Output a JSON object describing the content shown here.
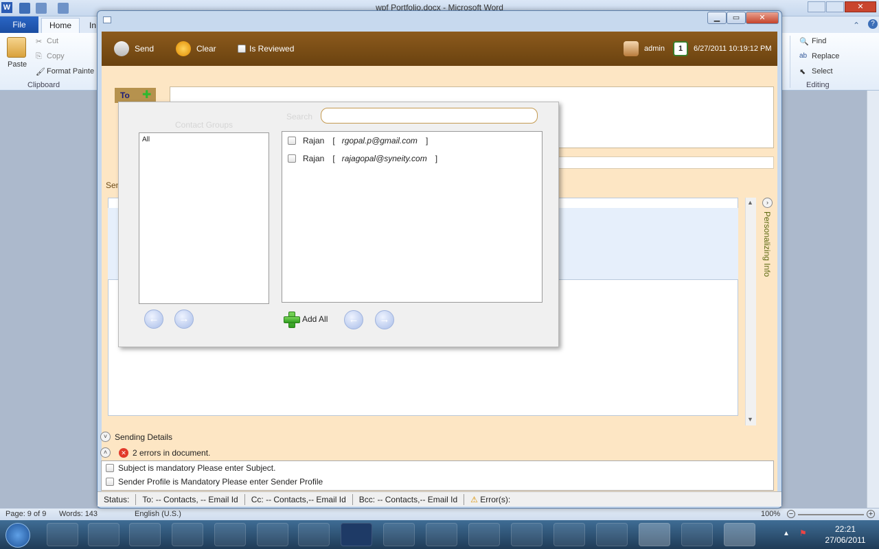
{
  "word": {
    "title": "wpf Portfolio.docx - Microsoft Word",
    "tabs": {
      "file": "File",
      "home": "Home",
      "insert": "In"
    },
    "clipboard": {
      "paste": "Paste",
      "cut": "Cut",
      "copy": "Copy",
      "format_painter": "Format Painte",
      "group": "Clipboard"
    },
    "editing": {
      "find": "Find",
      "replace": "Replace",
      "select": "Select",
      "group": "Editing"
    },
    "status": {
      "page": "Page: 9 of 9",
      "words": "Words: 143",
      "language": "English (U.S.)",
      "zoom": "100%"
    },
    "clock": {
      "time": "22:21",
      "date": "27/06/2011"
    }
  },
  "app": {
    "toolbar": {
      "send": "Send",
      "clear": "Clear",
      "reviewed": "Is Reviewed",
      "user": "admin",
      "datetime": "6/27/2011 10:19:12 PM"
    },
    "to_label": "To",
    "sender_label": "Sen",
    "personalizing": "Personalizing Info",
    "sending_details": "Sending Details",
    "errors_summary": "2 errors in document.",
    "errors": [
      "Subject is mandatory Please enter Subject.",
      "Sender Profile is Mandatory Please enter Sender Profile"
    ],
    "statusbar": {
      "status": "Status:",
      "to": "To: -- Contacts, -- Email Id",
      "cc": "Cc: -- Contacts,-- Email Id",
      "bcc": "Bcc: -- Contacts,-- Email Id",
      "errors": "Error(s):"
    }
  },
  "popup": {
    "contact_groups_label": "Contact Groups",
    "search_label": "Search",
    "search_value": "",
    "groups": [
      "All"
    ],
    "contacts": [
      {
        "name": "Rajan",
        "open": "[",
        "email": "rgopal.p@gmail.com",
        "close": "]"
      },
      {
        "name": "Rajan",
        "open": "[",
        "email": "rajagopal@syneity.com",
        "close": "]"
      }
    ],
    "add_all": "Add All"
  },
  "colors": {
    "toolbar_brown": "#7a4e16",
    "panel_peach": "#fde6c4",
    "search_border": "#c49a50"
  }
}
